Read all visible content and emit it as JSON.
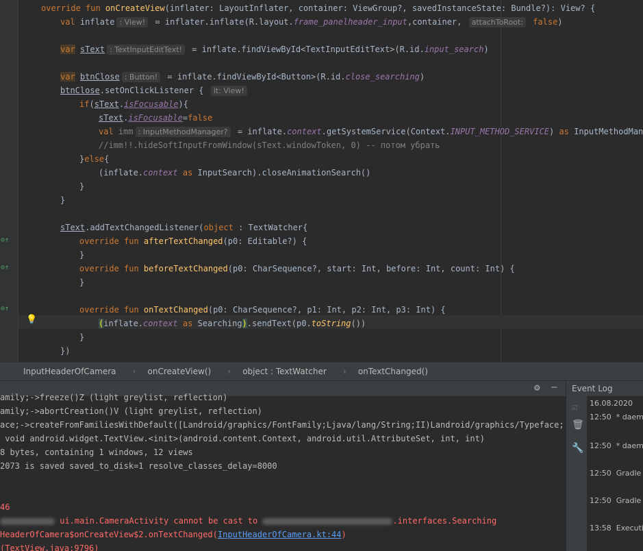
{
  "editor": {
    "lines": [
      "override fun onCreateView(inflater: LayoutInflater, container: ViewGroup?, savedInstanceState: Bundle?): View? {",
      "val inflate : View! = inflater.inflate(R.layout.frame_panelheader_input,container, attachToRoot: false)",
      "var sText : TextInputEditText! = inflate.findViewById<TextInputEditText>(R.id.input_search)",
      "var btnClose : Button! = inflate.findViewById<Button>(R.id.close_searching)",
      "btnClose.setOnClickListener { it: View!",
      "if(sText.isFocusable){",
      "sText.isFocusable=false",
      "val imm : InputMethodManager? = inflate.context.getSystemService(Context.INPUT_METHOD_SERVICE) as InputMethodManager",
      "//imm!!.hideSoftInputFromWindow(sText.windowToken, 0) -- потом убрать",
      "}else{",
      "(inflate.context as InputSearch).closeAnimationSearch()",
      "}",
      "}",
      "sText.addTextChangedListener(object : TextWatcher{",
      "override fun afterTextChanged(p0: Editable?) {",
      "}",
      "override fun beforeTextChanged(p0: CharSequence?, start: Int, before: Int, count: Int) {",
      "}",
      "override fun onTextChanged(p0: CharSequence?, p1: Int, p2: Int, p3: Int) {",
      "(inflate.context as Searching).sendText(p0.toString())",
      "}",
      "})"
    ]
  },
  "breadcrumb": [
    "InputHeaderOfCamera",
    "onCreateView()",
    "object : TextWatcher",
    "onTextChanged()"
  ],
  "run_log": {
    "lines": [
      "amily;->freeze()Z (light greylist, reflection)",
      "amily;->abortCreation()V (light greylist, reflection)",
      "ace;->createFromFamiliesWithDefault([Landroid/graphics/FontFamily;Ljava/lang/String;II)Landroid/graphics/Typeface; (lig",
      " void android.widget.TextView.<init>(android.content.Context, android.util.AttributeSet, int, int)",
      "8 bytes, containing 1 windows, 12 views",
      "2073 is saved saved_to_disk=1 resolve_classes_delay=8000",
      "46",
      "ui.main.CameraActivity cannot be cast to",
      ".interfaces.Searching",
      "HeaderOfCamera$onCreateView$2.onTextChanged(",
      "InputHeaderOfCamera.kt:44",
      ")",
      "(TextView.java:9796)"
    ]
  },
  "event_log": {
    "title": "Event Log",
    "date": "16.08.2020",
    "entries": [
      {
        "time": "12:50",
        "text": "* daemo"
      },
      {
        "time": "12:50",
        "text": "* daemo"
      },
      {
        "time": "12:50",
        "text": "Gradle s"
      },
      {
        "time": "12:50",
        "text": "Gradle s"
      },
      {
        "time": "13:58",
        "text": "Executin"
      }
    ]
  },
  "colors": {
    "keyword": "#cc7832",
    "function": "#ffc66d",
    "field": "#9876aa",
    "error": "#ff6b68",
    "link": "#589df6"
  }
}
